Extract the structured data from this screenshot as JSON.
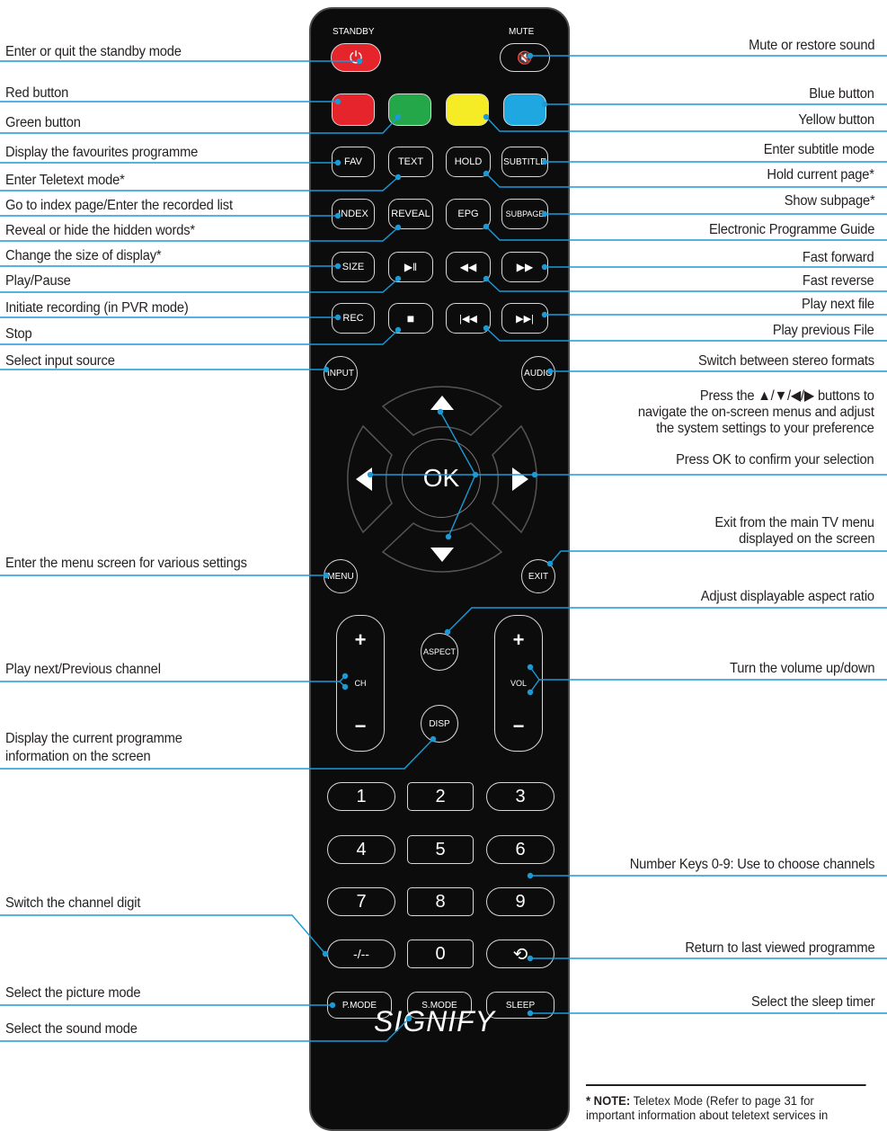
{
  "labels_left": [
    "Enter or quit the standby mode",
    "Red button",
    "Green button",
    "Display the favourites programme",
    "Enter Teletext mode*",
    "Go to index page/Enter the recorded list",
    "Reveal or hide the hidden words*",
    "Change the size of display*",
    "Play/Pause",
    "Initiate recording (in PVR mode)",
    "Stop",
    "Select input source",
    "Enter the menu screen for various settings",
    "Play next/Previous channel",
    "Display the current programme",
    "information on the screen",
    "Switch the channel digit",
    "Select the picture mode",
    "Select the sound mode"
  ],
  "labels_right": [
    "Mute or restore sound",
    "Blue button",
    "Yellow button",
    "Enter subtitle mode",
    "Hold current page*",
    "Show subpage*",
    "Electronic Programme Guide",
    "Fast forward",
    "Fast reverse",
    "Play next file",
    "Play previous File",
    "Switch between stereo formats",
    "Press the ▲/▼/◀/▶ buttons to",
    "navigate the on-screen menus and adjust",
    "the system settings to your preference",
    "Press OK to confirm your selection",
    "Exit from the main TV menu",
    "displayed on the screen",
    "Adjust displayable aspect ratio",
    "Turn the volume up/down",
    "Number Keys 0-9: Use to choose channels",
    "Return to last viewed programme",
    "Select the sleep timer"
  ],
  "remote": {
    "standby_caption": "STANDBY",
    "mute_caption": "MUTE",
    "power_glyph": "⏻",
    "mute_glyph": "🔇",
    "colors": {
      "red": "#e5242c",
      "green": "#24a748",
      "yellow": "#f6ec25",
      "blue": "#1ea7e1"
    },
    "row1": [
      "FAV",
      "TEXT",
      "HOLD",
      "SUBTITLE"
    ],
    "row2": [
      "INDEX",
      "REVEAL",
      "EPG",
      "SUBPAGE"
    ],
    "row3": [
      "SIZE",
      "▶‖",
      "◀◀",
      "▶▶"
    ],
    "row4": [
      "REC",
      "■",
      "|◀◀",
      "▶▶|"
    ],
    "input": "INPUT",
    "audio": "AUDIO",
    "ok": "OK",
    "menu": "MENU",
    "exit": "EXIT",
    "aspect": "ASPECT",
    "disp": "DISP",
    "ch": "CH",
    "vol": "VOL",
    "plus": "+",
    "minus": "−",
    "keys": [
      "1",
      "2",
      "3",
      "4",
      "5",
      "6",
      "7",
      "8",
      "9",
      "-/--",
      "0",
      "⟲"
    ],
    "pmode": "P.MODE",
    "smode": "S.MODE",
    "sleep": "SLEEP",
    "brand": "SIGNIFY"
  },
  "note": {
    "bold": "* NOTE:",
    "text": " Teletex Mode (Refer to page 31 for important information about teletext services in"
  },
  "line_color": "#1b9ad6"
}
